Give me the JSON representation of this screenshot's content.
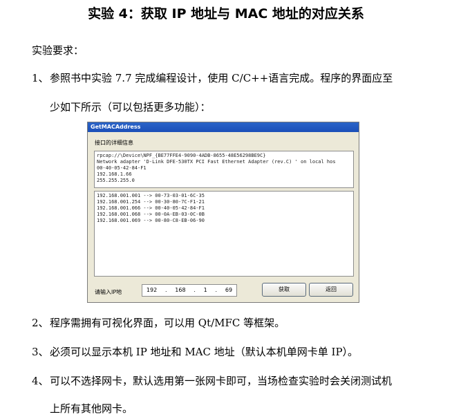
{
  "title": "实验 4：获取 IP 地址与 MAC 地址的对应关系",
  "requirements_label": "实验要求：",
  "items": [
    {
      "num": "1、",
      "lines": [
        "参照书中实验 7.7 完成编程设计，使用 C/C++语言完成。程序的界面应至",
        "少如下所示（可以包括更多功能）："
      ]
    },
    {
      "num": "2、",
      "lines": [
        "程序需拥有可视化界面，可以用 Qt/MFC 等框架。"
      ]
    },
    {
      "num": "3、",
      "lines": [
        "必须可以显示本机 IP 地址和 MAC 地址（默认本机单网卡单 IP）。"
      ]
    },
    {
      "num": "4、",
      "lines": [
        "可以不选择网卡，默认选用第一张网卡即可，当场检查实验时会关闭测试机",
        "上所有其他网卡。"
      ]
    }
  ],
  "window": {
    "title": "GetMACAddress",
    "group_label": "接口的详细信息",
    "info_lines": [
      "rpcap://\\Device\\NPF_{BE77FFE4-9090-4ADB-8655-48E56298BE9C}",
      "Network adapter 'D-Link DFE-530TX PCI Fast Ethernet Adapter (rev.C)        ' on local hos",
      "00-40-05-42-84-F1",
      "192.168.1.66",
      "255.255.255.0"
    ],
    "list_lines": [
      "192.168.001.001 -->  00-73-03-01-6C-35",
      "192.168.001.254 -->  00-30-80-7C-F1-21",
      "192.168.001.066 -->  00-40-05-42-84-F1",
      "192.168.001.068 -->  00-0A-EB-03-0C-0B",
      "192.168.001.069 -->  00-80-C8-EB-06-90"
    ],
    "ip_label": "请输入IP地",
    "ip_octets": [
      "192",
      "168",
      "1",
      "69"
    ],
    "get_button": "获取",
    "back_button": "返回"
  }
}
